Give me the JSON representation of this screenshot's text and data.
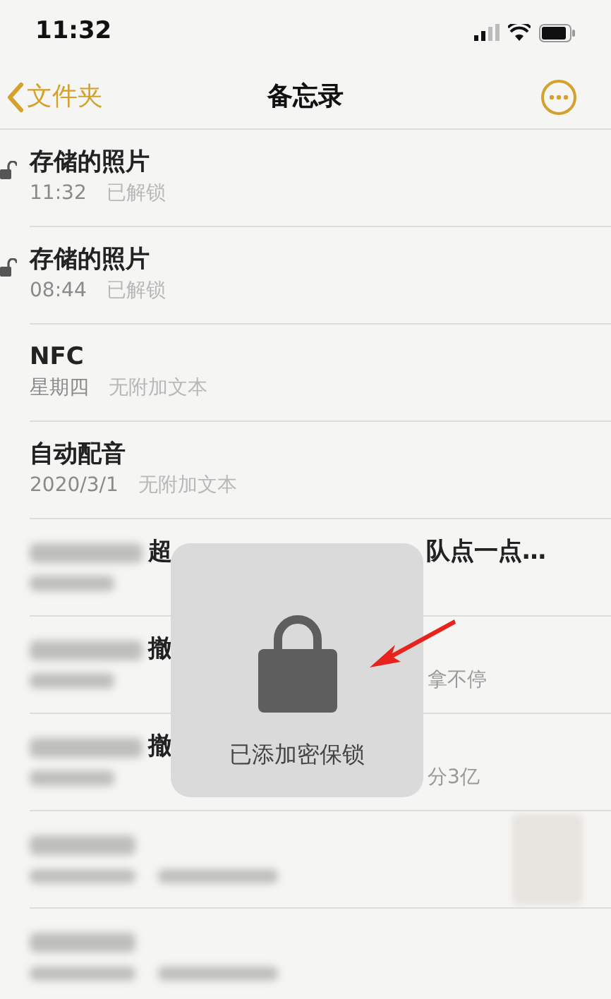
{
  "status_bar": {
    "time": "11:32"
  },
  "nav": {
    "back_label": "文件夹",
    "title": "备忘录"
  },
  "notes": [
    {
      "kind": "unlocked",
      "title": "存储的照片",
      "date": "11:32",
      "preview": "已解锁"
    },
    {
      "kind": "unlocked",
      "title": "存储的照片",
      "date": "08:44",
      "preview": "已解锁"
    },
    {
      "kind": "plain",
      "title": "NFC",
      "date": "星期四",
      "preview": "无附加文本"
    },
    {
      "kind": "plain",
      "title": "自动配音",
      "date": "2020/3/1",
      "preview": "无附加文本"
    },
    {
      "kind": "partial",
      "title_head": "超",
      "title_tail": "队点一点…"
    },
    {
      "kind": "partial",
      "title_head": "撤",
      "preview_tail": "拿不停"
    },
    {
      "kind": "partial",
      "title_head": "撤",
      "preview_tail": "分3亿"
    },
    {
      "kind": "redacted",
      "thumbnail": true
    },
    {
      "kind": "redacted"
    }
  ],
  "hud": {
    "message": "已添加密保锁"
  }
}
